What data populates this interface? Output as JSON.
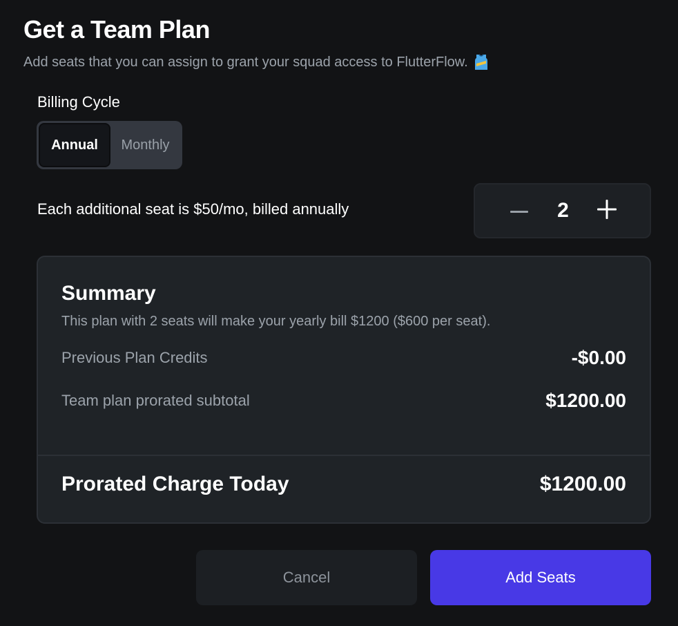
{
  "header": {
    "title": "Get a Team Plan",
    "subtitle": "Add seats that you can assign to grant your squad access to FlutterFlow.",
    "subtitle_icon": "jersey-icon"
  },
  "billing": {
    "label": "Billing Cycle",
    "options": [
      "Annual",
      "Monthly"
    ],
    "selected": "Annual"
  },
  "seats": {
    "info": "Each additional seat is $50/mo, billed annually",
    "count": "2",
    "decrement_icon": "minus-icon",
    "increment_icon": "plus-icon"
  },
  "summary": {
    "title": "Summary",
    "description": "This plan with 2 seats will make your yearly bill $1200 ($600 per seat).",
    "rows": [
      {
        "label": "Previous Plan Credits",
        "value": "-$0.00"
      },
      {
        "label": "Team plan prorated subtotal",
        "value": "$1200.00"
      }
    ],
    "total": {
      "label": "Prorated Charge Today",
      "value": "$1200.00"
    }
  },
  "actions": {
    "cancel": "Cancel",
    "confirm": "Add Seats"
  },
  "colors": {
    "background": "#121315",
    "accent": "#4839e6",
    "muted_text": "#9ca3ab"
  }
}
